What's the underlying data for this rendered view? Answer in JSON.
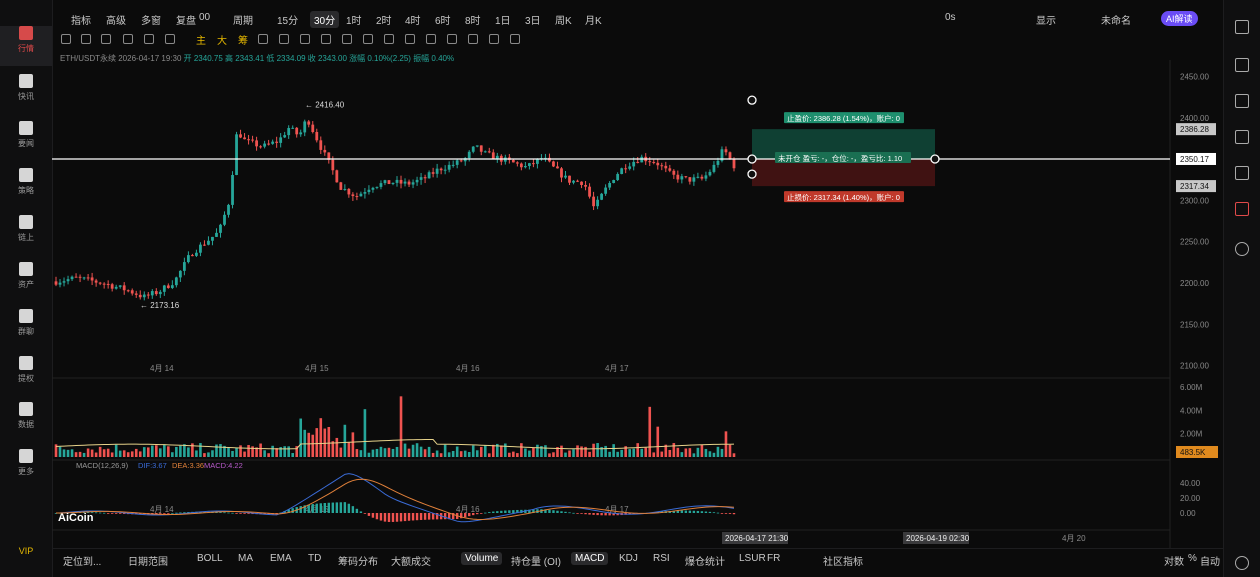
{
  "sidebar": {
    "items": [
      {
        "label": "行情",
        "icon": "chart-icon",
        "active": true
      },
      {
        "label": "快讯",
        "icon": "news-icon"
      },
      {
        "label": "要闻",
        "icon": "document-icon"
      },
      {
        "label": "策略",
        "icon": "robot-icon"
      },
      {
        "label": "链上",
        "icon": "chain-icon"
      },
      {
        "label": "资产",
        "icon": "wallet-icon"
      },
      {
        "label": "群聊",
        "icon": "chat-icon"
      },
      {
        "label": "提权",
        "icon": "key-icon"
      },
      {
        "label": "数据",
        "icon": "data-icon"
      },
      {
        "label": "更多",
        "icon": "grid-icon"
      }
    ],
    "vip": "VIP"
  },
  "topbar": {
    "items": [
      "指标",
      "高级",
      "多窗",
      "复盘",
      "00",
      "周期",
      "15分",
      "30分",
      "1时",
      "2时",
      "4时",
      "6时",
      "8时",
      "1日",
      "3日",
      "周K",
      "月K"
    ],
    "selected": "30分",
    "right": [
      "0s",
      "显示",
      "未命名"
    ],
    "ai_label": "AI解读"
  },
  "toolbar2": {
    "text_items": [
      "主",
      "大",
      "筹"
    ]
  },
  "info": {
    "symbol": "ETH/USDT永续",
    "time": "2026-04-17 19:30",
    "open": "开 2340.75",
    "high": "高 2343.41",
    "low": "低 2334.09",
    "close": "收 2343.00",
    "change": "涨幅 0.10%(2.25)",
    "amplitude": "振幅 0.40%"
  },
  "chart_data": {
    "type": "candlestick",
    "y_ticks": [
      "2450.00",
      "2400.00",
      "2350.00",
      "2300.00",
      "2250.00",
      "2200.00",
      "2150.00",
      "2100.00"
    ],
    "y_range": [
      2085,
      2470
    ],
    "x_labels": [
      "4月 14",
      "4月 15",
      "4月 16",
      "4月 17",
      "4月 20"
    ],
    "current_price": "2350.17",
    "take_profit": {
      "price": "2386.28",
      "label": "止盈价: 2386.28 (1.54%)，账户: 0"
    },
    "stop_loss": {
      "price": "2317.34",
      "label": "止损价: 2317.34 (1.40%)，账户: 0"
    },
    "position_label": "未开仓 盈亏: -，仓位: -，盈亏比: 1.10",
    "max_marker": "2416.40",
    "min_marker": "2173.16",
    "volume_ticks": [
      "6.00M",
      "4.00M",
      "2.00M"
    ],
    "volume_current": "483.5K",
    "macd_label": "MACD(12,26,9)",
    "dif": "DIF:3.67",
    "dea": "DEA:3.36",
    "macd": "MACD:4.22",
    "macd_ticks": [
      "40.00",
      "20.00",
      "0.00"
    ],
    "time_labels": [
      "2026-04-17 21:30",
      "2026-04-19 02:30"
    ],
    "colors": {
      "up": "#26a69a",
      "down": "#ef5350",
      "tp": "#1e8f6e",
      "sl": "#c0392b"
    }
  },
  "bottombar": {
    "left": [
      "定位到...",
      "日期范围"
    ],
    "items": [
      "BOLL",
      "MA",
      "EMA",
      "TD",
      "筹码分布",
      "大额成交",
      "Volume",
      "持仓量 (OI)",
      "MACD",
      "KDJ",
      "RSI",
      "爆仓统计",
      "LSUR",
      "FR",
      "社区指标"
    ],
    "selected": [
      "Volume",
      "MACD"
    ],
    "right": [
      "对数",
      "%",
      "自动"
    ]
  },
  "logo": "AiCoin"
}
